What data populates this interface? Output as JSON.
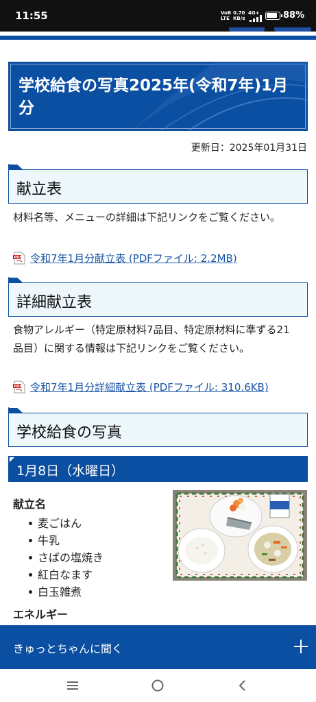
{
  "status_bar": {
    "time": "11:55",
    "signal_label_top": "VoB",
    "signal_label_bottom": "LTE",
    "speed_value": "0.70",
    "speed_unit": "KB/s",
    "network": "4G+",
    "battery_percent": "88%",
    "battery_level": 0.88
  },
  "page": {
    "title": "学校給食の写真2025年(令和7年)1月分",
    "updated": "更新日：2025年01月31日"
  },
  "sections": {
    "kondate": {
      "heading": "献立表",
      "description": "材料名等、メニューの詳細は下記リンクをご覧ください。",
      "link": "令和7年1月分献立表 (PDFファイル: 2.2MB)"
    },
    "shosai": {
      "heading": "詳細献立表",
      "description": "食物アレルギー（特定原材料7品目、特定原材料に準ずる21 品目）に関する情報は下記リンクをご覧ください。",
      "link": "令和7年1月分詳細献立表 (PDFファイル: 310.6KB)"
    },
    "photos": {
      "heading": "学校給食の写真"
    }
  },
  "day": {
    "heading": "1月8日（水曜日）",
    "menu_label": "献立名",
    "menu_items": [
      "麦ごはん",
      "牛乳",
      "さばの塩焼き",
      "紅白なます",
      "白玉雑煮"
    ],
    "energy_label": "エネルギー"
  },
  "ask_bar": {
    "label": "きゅっとちゃんに聞く"
  },
  "icons": {
    "pdf": "pdf-icon",
    "plus": "plus-icon",
    "nav_recent": "recent-apps-icon",
    "nav_home": "home-icon",
    "nav_back": "back-icon"
  },
  "colors": {
    "brand_blue": "#0b4fa2",
    "link": "#1a55a6",
    "heading_bg": "#eef7fc"
  }
}
